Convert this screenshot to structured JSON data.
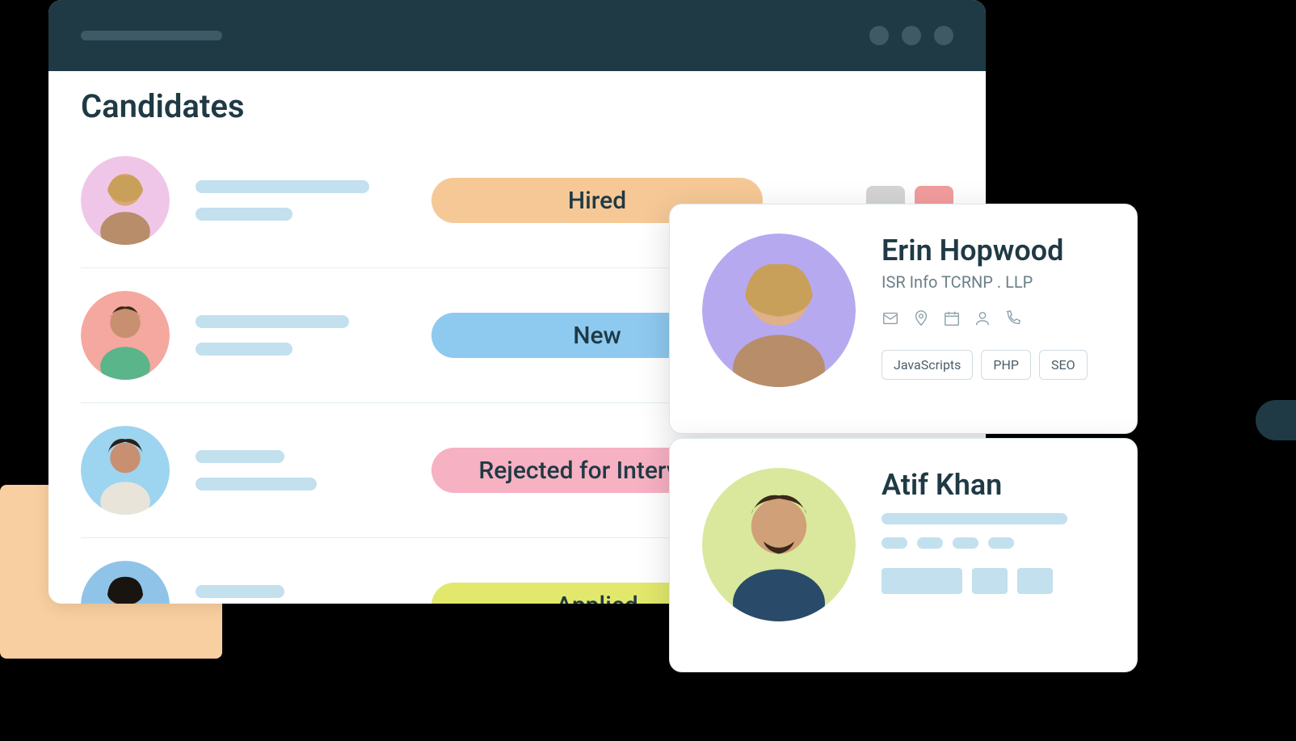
{
  "page": {
    "title": "Candidates"
  },
  "rows": [
    {
      "status": "Hired",
      "pillClass": "pill-hired",
      "avatarBg": "#f0c6e8"
    },
    {
      "status": "New",
      "pillClass": "pill-new",
      "avatarBg": "#f5a8a0"
    },
    {
      "status": "Rejected for Interview",
      "pillClass": "pill-rejected",
      "avatarBg": "#9dd4f0"
    },
    {
      "status": "Applied",
      "pillClass": "pill-applied",
      "avatarBg": "#8fc4e8"
    }
  ],
  "detail1": {
    "name": "Erin Hopwood",
    "subtitle": "ISR Info TCRNP . LLP",
    "tags": [
      "JavaScripts",
      "PHP",
      "SEO"
    ],
    "avatarBg": "#b7a9f0"
  },
  "detail2": {
    "name": "Atif Khan",
    "avatarBg": "#d9e89c"
  }
}
